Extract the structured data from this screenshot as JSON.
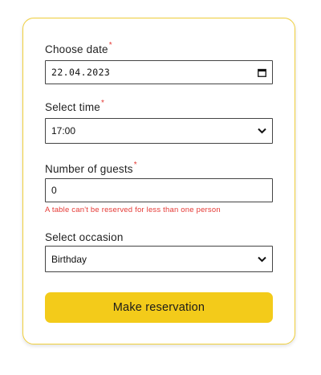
{
  "form": {
    "date": {
      "label": "Choose date",
      "required_mark": "*",
      "value": "22.04.2023",
      "icon": "calendar-icon"
    },
    "time": {
      "label": "Select time",
      "required_mark": "*",
      "value": "17:00",
      "icon": "chevron-down-icon"
    },
    "guests": {
      "label": "Number of guests",
      "required_mark": "*",
      "value": "0",
      "error": "A table can't be reserved for less than one person"
    },
    "occasion": {
      "label": "Select occasion",
      "value": "Birthday",
      "icon": "chevron-down-icon"
    },
    "submit_label": "Make reservation"
  },
  "colors": {
    "accent": "#f3cb1a",
    "card_border": "#f0cf3b",
    "error": "#e53935"
  }
}
